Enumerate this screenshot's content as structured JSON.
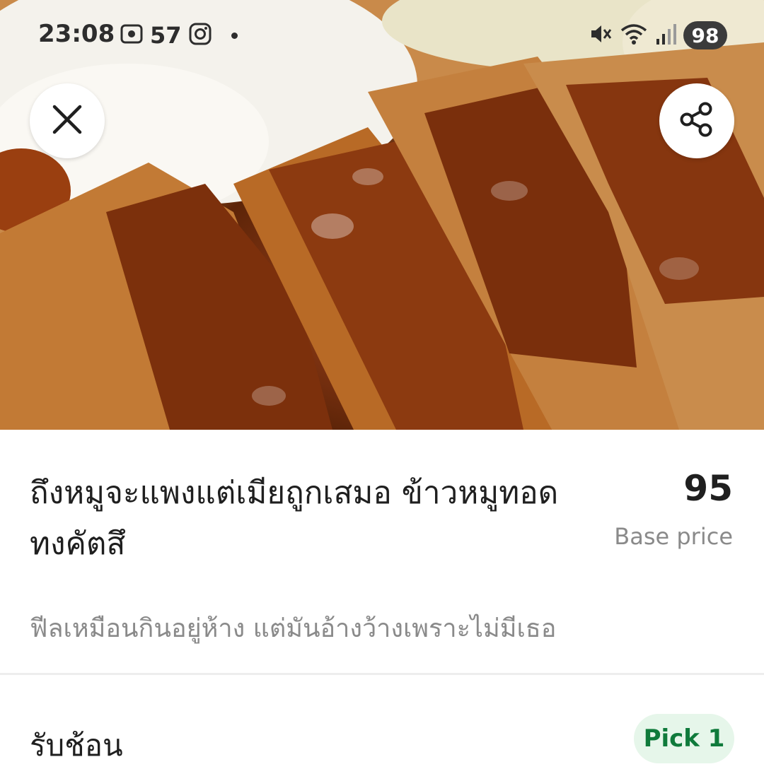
{
  "status_bar": {
    "time": "23:08",
    "notification_count": "57",
    "battery": "98",
    "icons": [
      "screen-record-icon",
      "instagram-icon",
      "mute-icon",
      "wifi-icon",
      "signal-icon"
    ]
  },
  "hero": {
    "image": "pork-cutlet-with-rice-photo"
  },
  "actions": {
    "close_icon": "close-icon",
    "share_icon": "share-icon"
  },
  "item": {
    "title": "ถึงหมูจะแพงแต่เมียถูกเสมอ ข้าวหมูทอดทงคัตสึ",
    "price": "95",
    "price_label": "Base price",
    "description": "ฟีลเหมือนกินอยู่ห้าง แต่มันอ้างว้างเพราะไม่มีเธอ"
  },
  "options": {
    "title": "รับช้อน",
    "badge": "Pick 1"
  },
  "colors": {
    "accent_green": "#0f7a3b",
    "badge_bg": "#e6f6ea",
    "secondary_text": "#8a8a8a"
  }
}
